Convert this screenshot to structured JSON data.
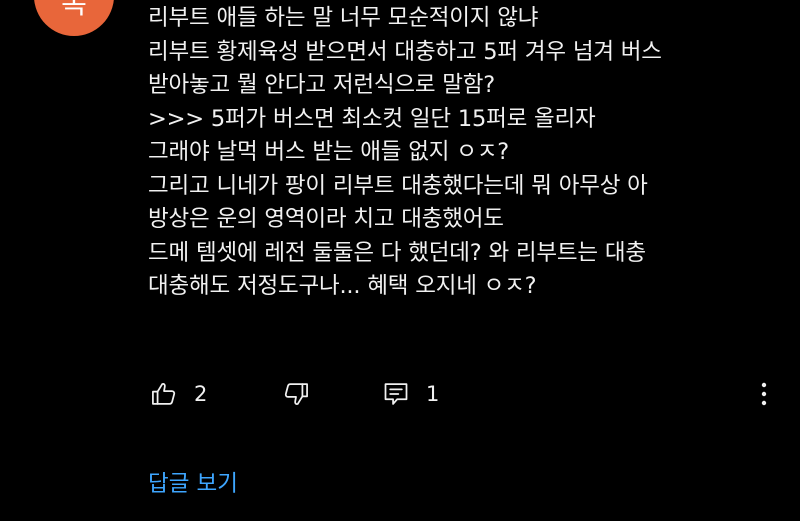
{
  "avatar": {
    "letter": "복",
    "color": "#e8663a"
  },
  "comment": {
    "lines": [
      "리부트 애들 하는 말 너무 모순적이지 않냐",
      "리부트 황제육성 받으면서 대충하고 5퍼 겨우 넘겨 버스",
      "받아놓고 뭘 안다고 저런식으로 말함?",
      ">>> 5퍼가 버스면 최소컷 일단 15퍼로 올리자",
      "그래야 날먹 버스 받는 애들 없지 ㅇㅈ?",
      "그리고 니네가 팡이 리부트 대충했다는데 뭐 아무상 아",
      "방상은 운의 영역이라 치고 대충했어도",
      "드메 템셋에 레전 둘둘은 다 했던데? 와 리부트는 대충",
      "대충해도 저정도구나... 혜택 오지네 ㅇㅈ?"
    ]
  },
  "actions": {
    "like_icon": "thumbs-up-icon",
    "like_count": "2",
    "dislike_icon": "thumbs-down-icon",
    "reply_icon": "reply-comment-icon",
    "reply_count": "1",
    "more_icon": "vertical-ellipsis-icon"
  },
  "view_replies": {
    "label": "답글 보기",
    "color": "#3ea6ff"
  }
}
